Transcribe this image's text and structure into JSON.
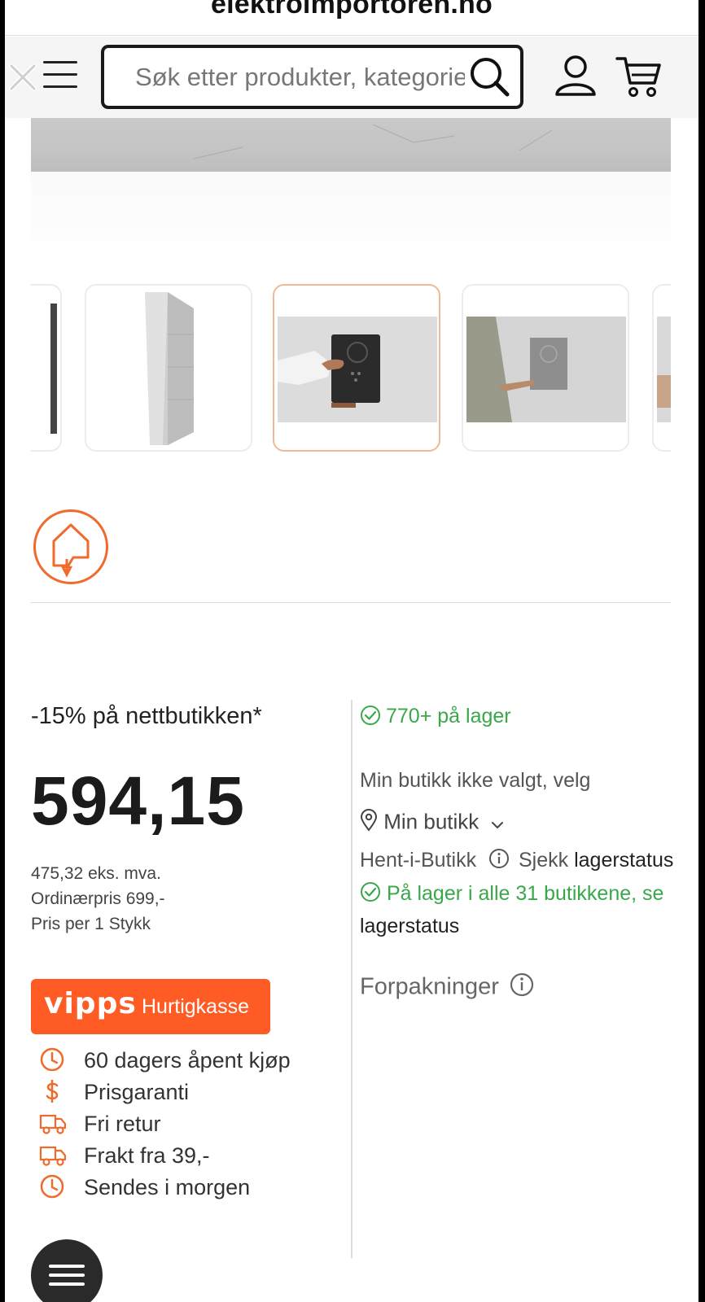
{
  "browser": {
    "url": "elektroimportoren.no"
  },
  "header": {
    "search_placeholder": "Søk etter produkter, kategorier",
    "menu_icon": "menu-icon",
    "close_icon": "close-icon",
    "search_icon": "search-icon",
    "account_icon": "user-icon",
    "cart_icon": "cart-icon"
  },
  "gallery": {
    "thumbnails": [
      "product-side-view",
      "product-front-hand-keypad",
      "product-wall-hand"
    ],
    "selected_index": 2
  },
  "pricing": {
    "discount_note": "-15% på nettbutikken*",
    "price": "594,15",
    "price_ex_vat": "475,32 eks. mva.",
    "regular_price": "Ordinærpris 699,-",
    "unit_price": "Pris per 1 Stykk"
  },
  "checkout": {
    "vipps_logo": "vipps",
    "vipps_label": "Hurtigkasse",
    "brand_color": "#ff5b24"
  },
  "usps": [
    {
      "icon": "clock-icon",
      "text": "60 dagers åpent kjøp"
    },
    {
      "icon": "dollar-icon",
      "text": "Prisgaranti"
    },
    {
      "icon": "truck-icon",
      "text": "Fri retur"
    },
    {
      "icon": "truck-icon",
      "text": "Frakt fra 39,-"
    },
    {
      "icon": "clock-icon",
      "text": "Sendes i morgen"
    }
  ],
  "availability": {
    "online_stock": "770+ på lager",
    "shop_not_selected": "Min butikk ikke valgt, velg",
    "my_shop": "Min butikk",
    "pickup_label": "Hent-i-Butikk",
    "check_label": "Sjekk",
    "check_link": "lagerstatus",
    "all_stores": "På lager i alle 31 butikkene, se",
    "all_stores_link": "lagerstatus",
    "packaging_label": "Forpakninger",
    "in_stock_color": "#3aa84a"
  }
}
